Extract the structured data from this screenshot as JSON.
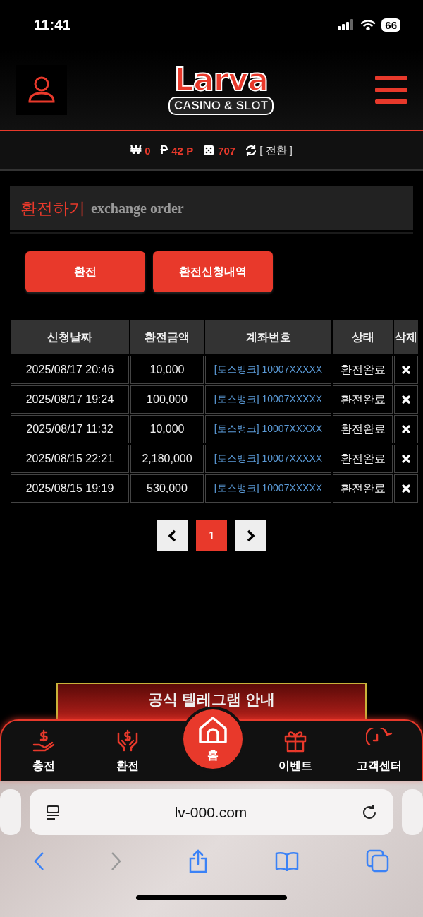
{
  "status_bar": {
    "time": "11:41",
    "battery": "66"
  },
  "header": {
    "logo": {
      "title": "Larva",
      "subtitle": "CASINO & SLOT"
    }
  },
  "balance": {
    "items": [
      {
        "kind": "currency",
        "symbol": "₩",
        "value": "0"
      },
      {
        "kind": "currency",
        "symbol": "₱",
        "value": "42 P"
      },
      {
        "kind": "dice",
        "value": "707"
      }
    ],
    "switch_label": "[ 전환 ]"
  },
  "page_title": {
    "title": "환전하기",
    "subtitle": "exchange order"
  },
  "buttons": [
    "환전",
    "환전신청내역"
  ],
  "table": {
    "columns": [
      "신청날짜",
      "환전금액",
      "계좌번호",
      "상태",
      "삭제"
    ],
    "rows": [
      {
        "date": "2025/08/17 20:46",
        "amount": "10,000",
        "account": "[토스뱅크] 10007XXXXX",
        "status": "환전완료"
      },
      {
        "date": "2025/08/17 19:24",
        "amount": "100,000",
        "account": "[토스뱅크] 10007XXXXX",
        "status": "환전완료"
      },
      {
        "date": "2025/08/17 11:32",
        "amount": "10,000",
        "account": "[토스뱅크] 10007XXXXX",
        "status": "환전완료"
      },
      {
        "date": "2025/08/15 22:21",
        "amount": "2,180,000",
        "account": "[토스뱅크] 10007XXXXX",
        "status": "환전완료"
      },
      {
        "date": "2025/08/15 19:19",
        "amount": "530,000",
        "account": "[토스뱅크] 10007XXXXX",
        "status": "환전완료"
      }
    ]
  },
  "pagination": {
    "pages": [
      {
        "label": "1",
        "selected": true
      }
    ]
  },
  "banner": {
    "title": "공식 텔레그램 안내"
  },
  "bottom_nav": {
    "items": [
      {
        "kind": "charge",
        "label": "충전"
      },
      {
        "kind": "exchange",
        "label": "환전"
      },
      {
        "kind": "home",
        "label": "홈"
      },
      {
        "kind": "event",
        "label": "이벤트"
      },
      {
        "kind": "support",
        "label": "고객센터"
      }
    ]
  },
  "browser": {
    "url": "lv-000.com"
  }
}
